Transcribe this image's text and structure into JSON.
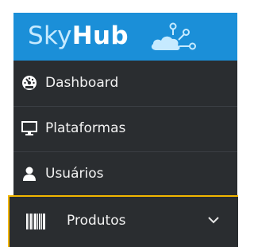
{
  "brand": {
    "sky": "Sky",
    "hub": "Hub",
    "logo_icon": "cloud-network-icon",
    "color": "#1b8fd8"
  },
  "nav": {
    "items": [
      {
        "label": "Dashboard",
        "icon": "dashboard-icon"
      },
      {
        "label": "Plataformas",
        "icon": "monitor-icon"
      },
      {
        "label": "Usuários",
        "icon": "user-icon"
      },
      {
        "label": "Produtos",
        "icon": "barcode-icon",
        "active": true,
        "expandable": true
      }
    ],
    "highlight_color": "#f2b600",
    "background": "#2a2d30"
  }
}
